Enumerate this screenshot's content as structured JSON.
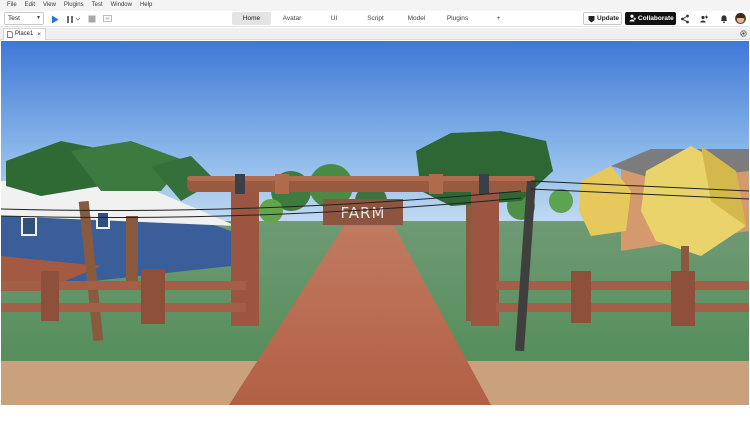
{
  "menu": [
    "File",
    "Edit",
    "View",
    "Plugins",
    "Test",
    "Window",
    "Help"
  ],
  "toolbar": {
    "mode_value": "Test",
    "tabs": [
      {
        "label": "Home",
        "active": true
      },
      {
        "label": "Avatar",
        "active": false
      },
      {
        "label": "UI",
        "active": false
      },
      {
        "label": "Script",
        "active": false
      },
      {
        "label": "Model",
        "active": false
      },
      {
        "label": "Plugins",
        "active": false
      },
      {
        "label": "+",
        "active": false
      }
    ],
    "update_label": "Update",
    "collaborate_label": "Collaborate"
  },
  "document_tab": {
    "label": "Place1",
    "close": "×"
  },
  "viewport": {
    "sign_text": "FARM"
  },
  "colors": {
    "accent_play": "#2b73d8",
    "collaborate_bg": "#111111",
    "active_tab_bg": "#e4e4e4"
  },
  "icons": [
    "play-icon",
    "pause-icon",
    "stop-icon",
    "screen-icon",
    "update-icon",
    "user-plus-icon",
    "share-icon",
    "team-icon",
    "bell-icon",
    "gear-icon",
    "file-icon"
  ]
}
